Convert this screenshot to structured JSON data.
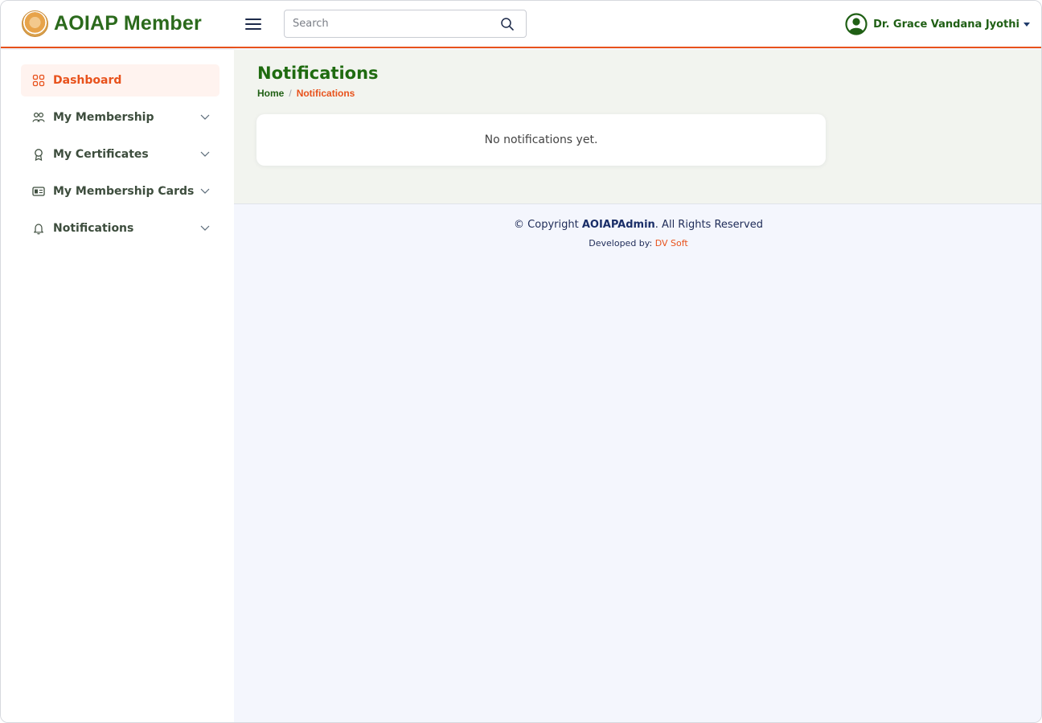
{
  "app": {
    "title": "AOIAP Member",
    "accent_color": "#e8521c",
    "brand_color": "#2b6a1c"
  },
  "header": {
    "menu_icon": "hamburger-menu-icon",
    "search": {
      "placeholder": "Search",
      "value": "",
      "icon": "search-icon"
    },
    "user": {
      "name": "Dr. Grace Vandana Jyothi",
      "icon": "user-circle-icon"
    }
  },
  "sidebar": {
    "items": [
      {
        "label": "Dashboard",
        "icon": "dashboard-grid-icon",
        "active": true
      },
      {
        "label": "My Membership",
        "icon": "people-icon"
      },
      {
        "label": "My Certificates",
        "icon": "certificate-icon"
      },
      {
        "label": "My Membership Cards",
        "icon": "id-card-icon"
      },
      {
        "label": "Notifications",
        "icon": "bell-icon"
      }
    ]
  },
  "main": {
    "title": "Notifications",
    "breadcrumb": {
      "home": "Home",
      "separator": "/",
      "current": "Notifications"
    },
    "card_message": "No notifications yet."
  },
  "footer": {
    "copyright_prefix": "© Copyright",
    "copyright_brand": "AOIAPAdmin",
    "copyright_suffix": ". All Rights Reserved",
    "developed_label": "Developed by:",
    "developer": "DV Soft"
  }
}
